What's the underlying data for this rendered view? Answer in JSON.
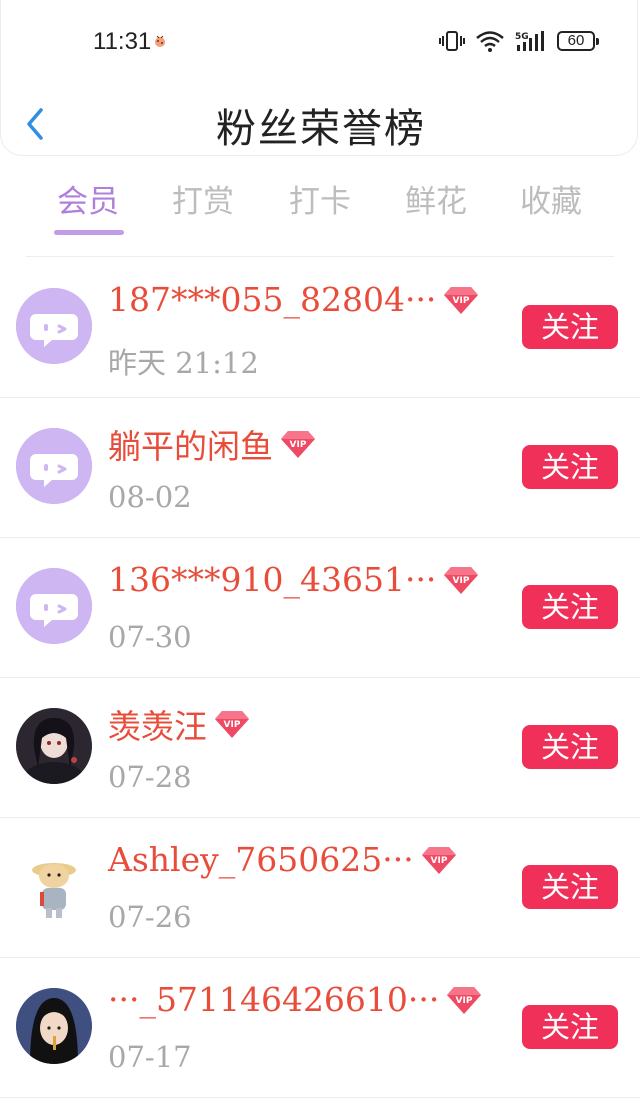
{
  "status_bar": {
    "time": "11:31",
    "battery": "60"
  },
  "header": {
    "title": "粉丝荣誉榜"
  },
  "tabs": [
    "会员",
    "打赏",
    "打卡",
    "鲜花",
    "收藏"
  ],
  "follow_label": "关注",
  "fans": [
    {
      "name": "187***055_82804···",
      "time": "昨天 21:12",
      "avatar": "default-avatar"
    },
    {
      "name": "躺平的闲鱼",
      "time": "08-02",
      "avatar": "default-avatar"
    },
    {
      "name": "136***910_43651···",
      "time": "07-30",
      "avatar": "default-avatar"
    },
    {
      "name": "羡羡汪",
      "time": "07-28",
      "avatar": "photo-avatar"
    },
    {
      "name": "Ashley_7650625···",
      "time": "07-26",
      "avatar": "photo-avatar"
    },
    {
      "name": "···_571146426610···",
      "time": "07-17",
      "avatar": "photo-avatar"
    }
  ]
}
